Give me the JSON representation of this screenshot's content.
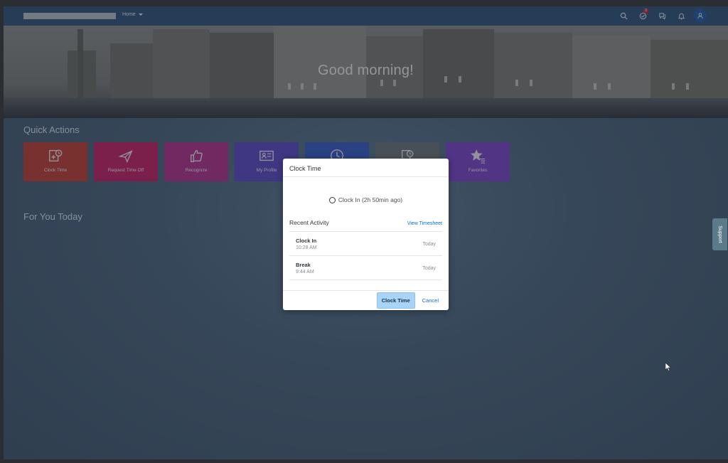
{
  "shell": {
    "home_label": "Home",
    "notifications_badge": "3"
  },
  "hero": {
    "greeting": "Good morning!"
  },
  "quick_actions": {
    "title": "Quick Actions",
    "tiles": [
      {
        "label": "Clock Time",
        "color": "#c3392d",
        "icon": "clock-time-icon"
      },
      {
        "label": "Request Time Off",
        "color": "#c71a5e",
        "icon": "airplane-icon"
      },
      {
        "label": "Recognize",
        "color": "#b22d87",
        "icon": "thumbs-up-icon"
      },
      {
        "label": "My Profile",
        "color": "#5a44c2",
        "icon": "profile-card-icon"
      },
      {
        "label": "",
        "color": "#3457c4",
        "icon": "clock-icon"
      },
      {
        "label": "",
        "color": "#6b6f74",
        "icon": "timesheet-icon"
      },
      {
        "label": "Favorites",
        "color": "#7b3fc7",
        "icon": "star-icon"
      }
    ]
  },
  "for_you": {
    "title": "For You Today"
  },
  "support": {
    "label": "Support"
  },
  "dialog": {
    "title": "Clock Time",
    "status": "Clock In (2h 50min ago)",
    "recent_title": "Recent Activity",
    "view_timesheet": "View Timesheet",
    "activities": [
      {
        "name": "Clock In",
        "time": "10:28 AM",
        "date": "Today"
      },
      {
        "name": "Break",
        "time": "9:44 AM",
        "date": "Today"
      }
    ],
    "primary_button": "Clock Time",
    "cancel_button": "Cancel"
  }
}
